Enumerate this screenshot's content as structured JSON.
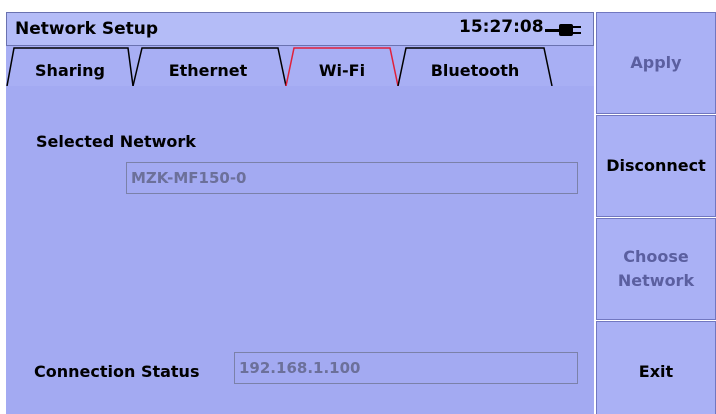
{
  "header": {
    "title": "Network Setup",
    "time": "15:27:08"
  },
  "tabs": [
    {
      "label": "Sharing"
    },
    {
      "label": "Ethernet"
    },
    {
      "label": "Wi-Fi"
    },
    {
      "label": "Bluetooth"
    }
  ],
  "selected_tab": "Wi-Fi",
  "main": {
    "selected_network_label": "Selected Network",
    "selected_network_value": "MZK-MF150-0",
    "connection_status_label": "Connection Status",
    "connection_status_value": "192.168.1.100"
  },
  "softkeys": [
    {
      "label": "Apply",
      "enabled": false
    },
    {
      "label": "Disconnect",
      "enabled": true
    },
    {
      "label": "Choose Network",
      "enabled": false
    },
    {
      "label": "Exit",
      "enabled": true
    }
  ],
  "colors": {
    "background": "#a3aaf2",
    "active_tab_border": "#e0203a",
    "softkey_disabled_text": "#5b5fa0"
  },
  "icons": {
    "power": "plug-icon"
  }
}
